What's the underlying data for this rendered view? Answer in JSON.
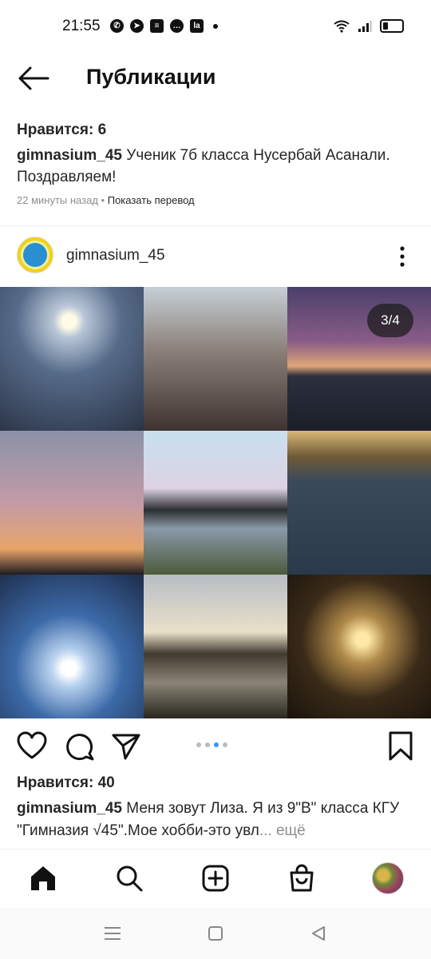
{
  "status_bar": {
    "time": "21:55",
    "notification_icons": [
      "whatsapp-icon",
      "telegram-icon",
      "messages-icon",
      "chat-icon",
      "app-icon"
    ],
    "right_icons": [
      "wifi-icon",
      "signal-icon",
      "battery-icon"
    ]
  },
  "header": {
    "title": "Публикации"
  },
  "previous_post": {
    "likes": "Нравится: 6",
    "username": "gimnasium_45",
    "caption": "Ученик 7б класса Нусербай Асанали. Поздравляем!",
    "time_ago": "22 минуты назад",
    "separator": "•",
    "translate": "Показать перевод"
  },
  "post": {
    "username": "gimnasium_45",
    "counter": "3/4",
    "carousel": {
      "count": 4,
      "active_index": 2
    },
    "likes": "Нравится: 40",
    "caption": "Меня зовут Лиза. Я из 9\"В\" класса КГУ \"Гимназия √45\".Мое хобби-это увл",
    "ellipsis": "...",
    "more": "ещё"
  },
  "colors": {
    "accent": "#3897f0",
    "text": "#262626",
    "muted": "#8e8e8e"
  }
}
